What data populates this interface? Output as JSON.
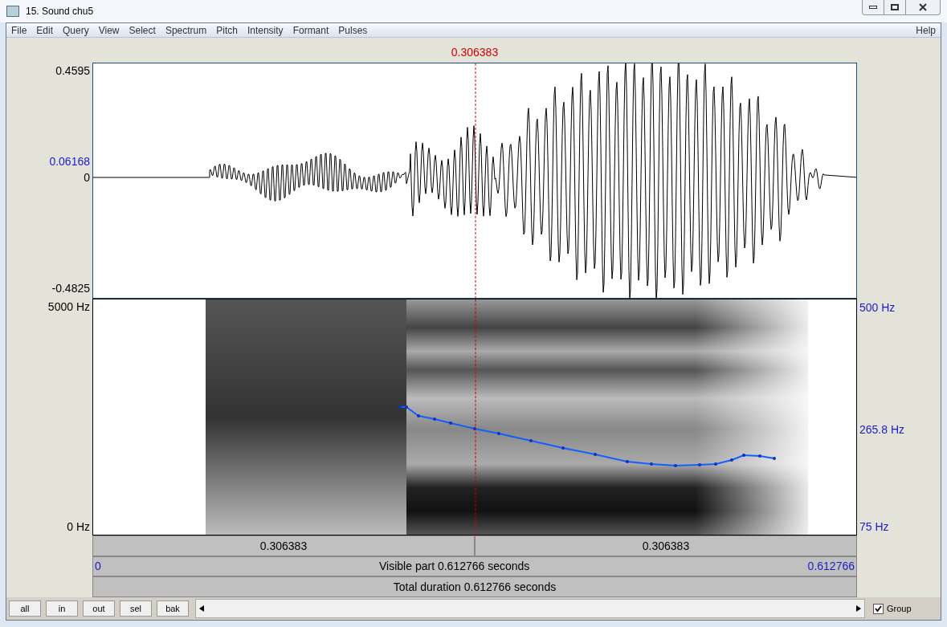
{
  "window": {
    "title": "15. Sound chu5"
  },
  "menu": {
    "items": [
      "File",
      "Edit",
      "Query",
      "View",
      "Select",
      "Spectrum",
      "Pitch",
      "Intensity",
      "Formant",
      "Pulses"
    ],
    "help": "Help"
  },
  "cursor": {
    "time": "0.306383"
  },
  "waveform": {
    "y_max": "0.4595",
    "y_mark": "0.06168",
    "y_zero": "0",
    "y_min": "-0.4825"
  },
  "spectrogram": {
    "f_max": "5000 Hz",
    "f_min": "0 Hz",
    "pitch_max": "500 Hz",
    "pitch_mark": "265.8 Hz",
    "pitch_min": "75 Hz"
  },
  "time_bars": {
    "segments": [
      "0.306383",
      "0.306383"
    ],
    "visible_start": "0",
    "visible": "Visible part 0.612766 seconds",
    "visible_end": "0.612766",
    "total": "Total duration 0.612766 seconds"
  },
  "buttons": [
    "all",
    "in",
    "out",
    "sel",
    "bak"
  ],
  "group": {
    "label": "Group",
    "checked": true
  }
}
